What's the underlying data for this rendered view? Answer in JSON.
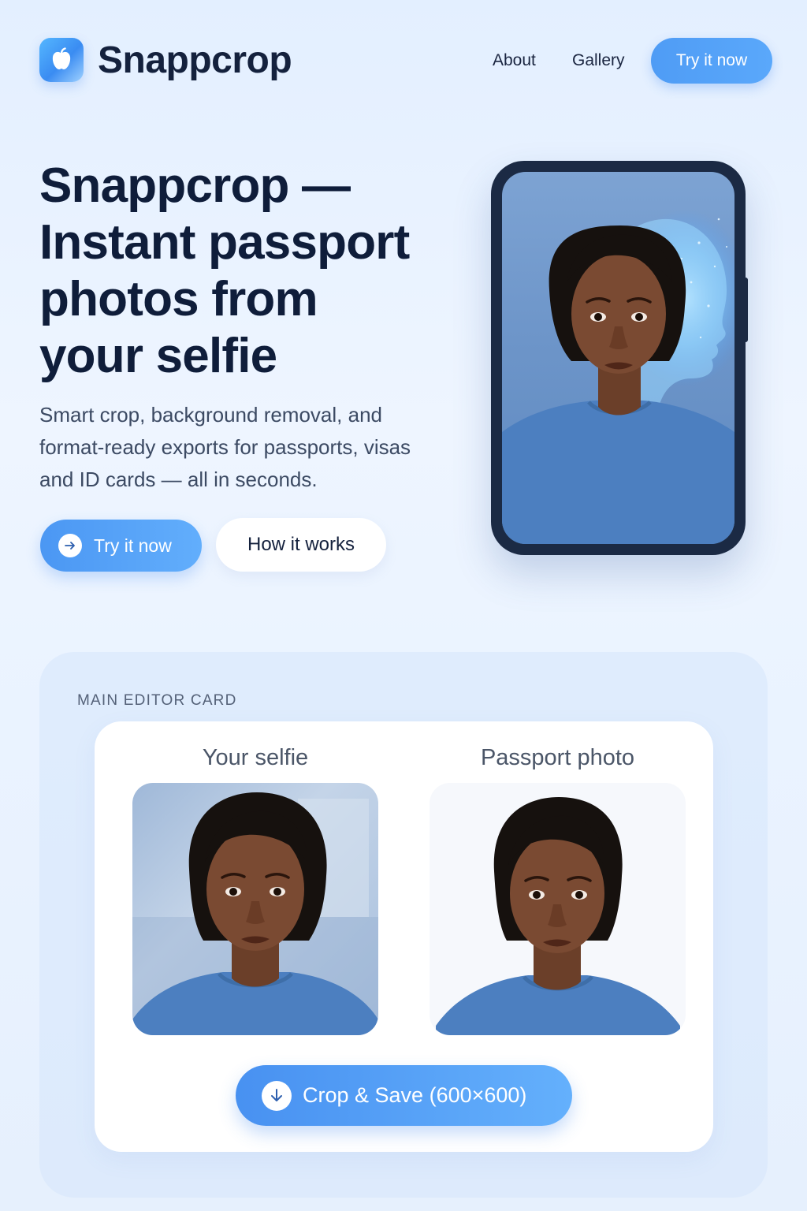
{
  "header": {
    "brand": "Snappcrop",
    "nav": {
      "about": "About",
      "gallery": "Gallery",
      "cta": "Try it now"
    }
  },
  "hero": {
    "title_lines": [
      "Snappcrop —",
      "Instant passport",
      "photos from",
      "your selfie"
    ],
    "subtitle": "Smart crop, background removal, and format-ready exports for passports, visas and ID cards — all in seconds.",
    "primary_button": "Try it now",
    "secondary_button": "How it works"
  },
  "editor": {
    "eyebrow": "MAIN EDITOR CARD",
    "selfie_title": "Your selfie",
    "passport_title": "Passport photo",
    "save_button": "Crop & Save (600×600)"
  },
  "colors": {
    "accent": "#4f9cf5",
    "text_dark": "#0f1d3a",
    "shirt": "#4c7fc0",
    "skin": "#7a4a32",
    "hair": "#17120f"
  },
  "icons": {
    "logo": "apple-icon",
    "primary_button": "arrow-right-icon",
    "save_button": "arrow-down-icon"
  }
}
